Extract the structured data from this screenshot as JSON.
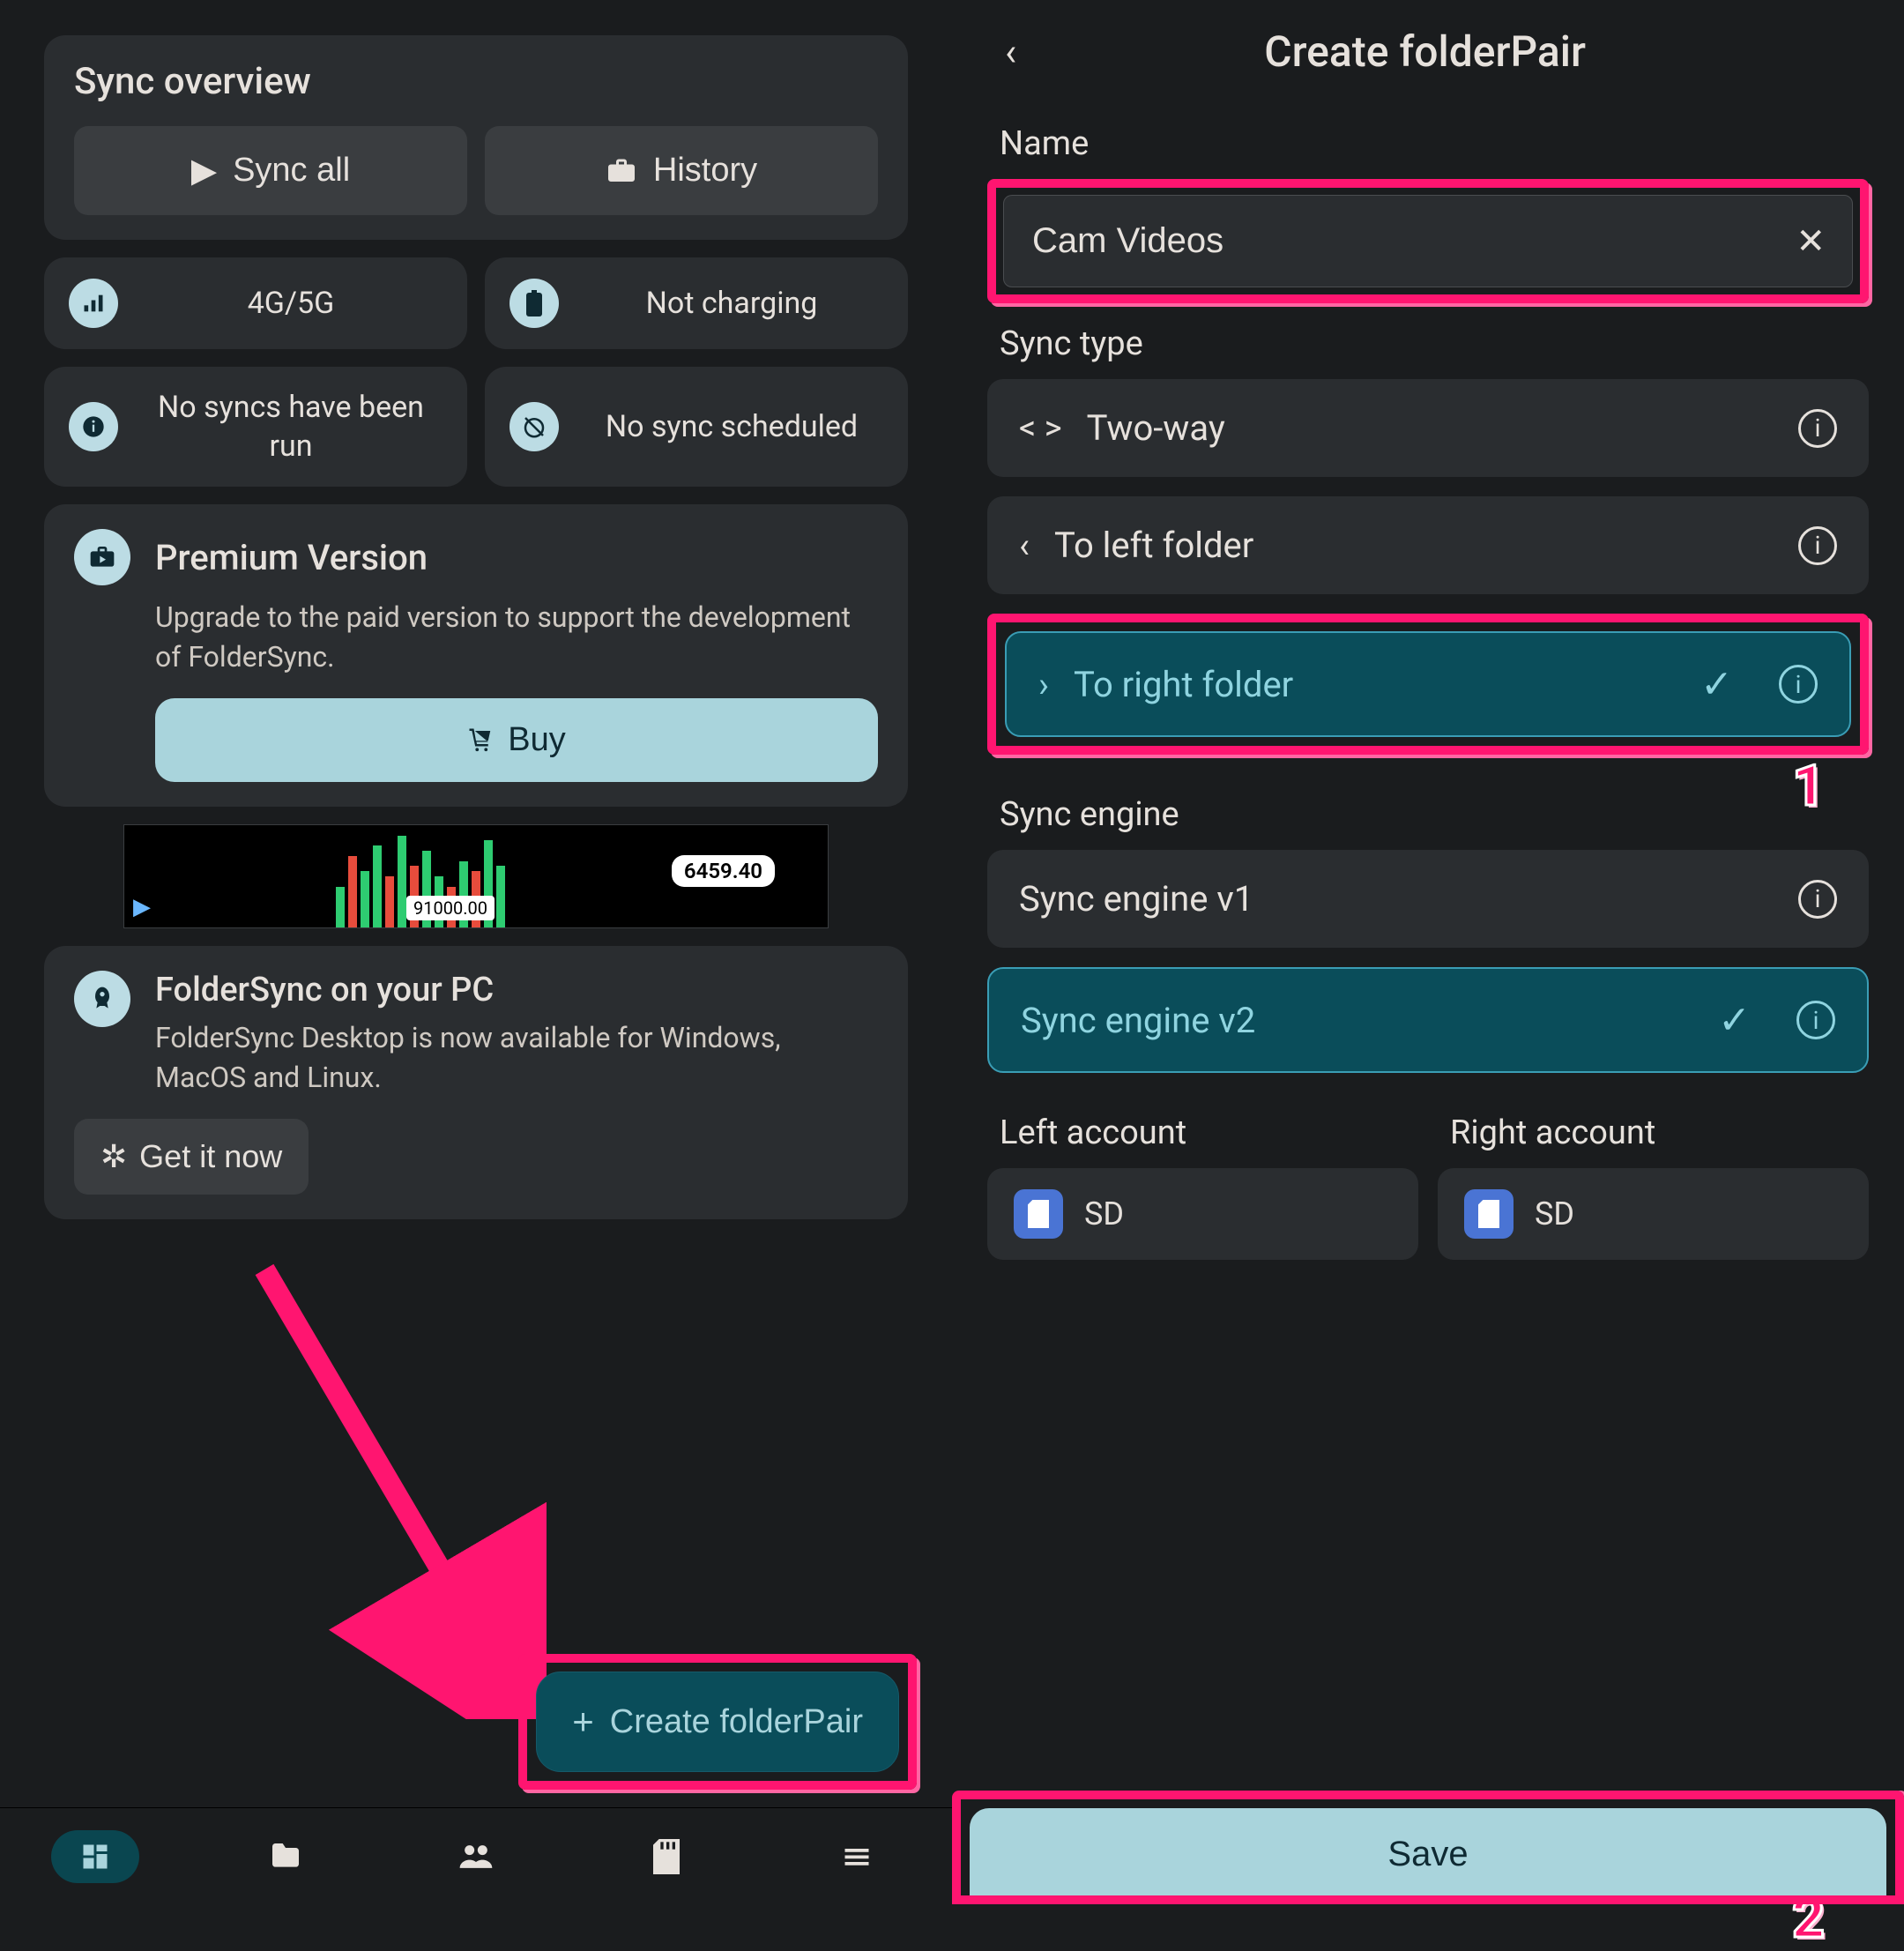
{
  "left": {
    "title": "Sync overview",
    "sync_all": "Sync all",
    "history": "History",
    "status": {
      "network": "4G/5G",
      "battery": "Not charging",
      "syncs": "No syncs have been run",
      "schedule": "No sync scheduled"
    },
    "premium": {
      "title": "Premium Version",
      "body": "Upgrade to the paid version to support the development of FolderSync.",
      "buy": "Buy"
    },
    "ad": {
      "price_high": "6459.40",
      "price_low": "91000.00"
    },
    "pc": {
      "title": "FolderSync on your PC",
      "body": "FolderSync Desktop is now available for Windows, MacOS and Linux.",
      "get": "Get it now"
    },
    "create": "Create folderPair"
  },
  "right": {
    "title": "Create folderPair",
    "name_label": "Name",
    "name_value": "Cam Videos",
    "sync_type_label": "Sync type",
    "two_way": "Two-way",
    "to_left": "To left folder",
    "to_right": "To right folder",
    "engine_label": "Sync engine",
    "engine_v1": "Sync engine v1",
    "engine_v2": "Sync engine v2",
    "left_account": "Left account",
    "right_account": "Right account",
    "sd": "SD",
    "save": "Save"
  },
  "callouts": {
    "one": "1",
    "two": "2"
  }
}
